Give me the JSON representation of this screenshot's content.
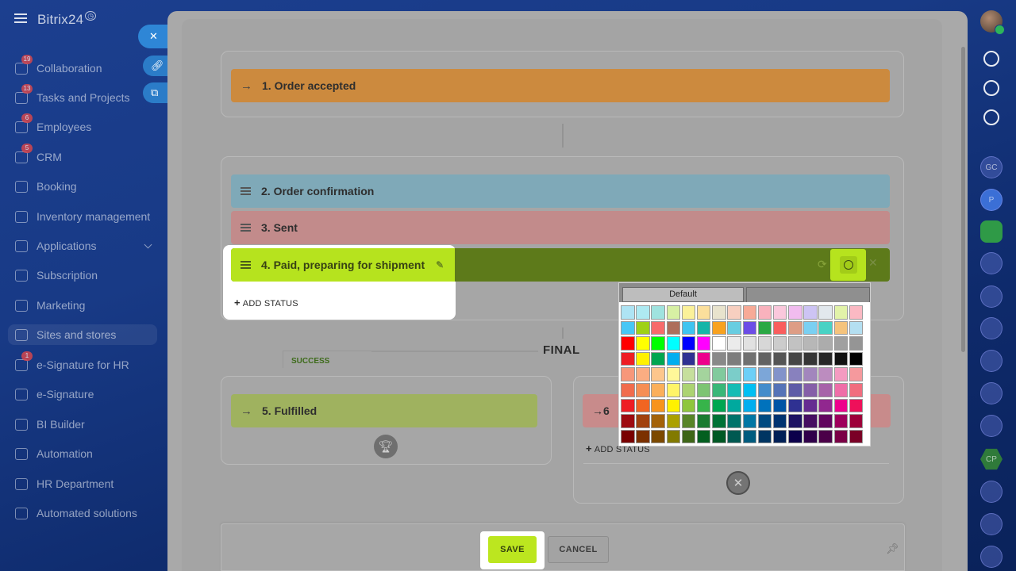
{
  "app": {
    "logo": "Bitrix24"
  },
  "sidebar": {
    "items": [
      {
        "label": "Collaboration",
        "badge": "19"
      },
      {
        "label": "Tasks and Projects",
        "badge": "13"
      },
      {
        "label": "Employees",
        "badge": "6"
      },
      {
        "label": "CRM",
        "badge": "5"
      },
      {
        "label": "Booking",
        "badge": ""
      },
      {
        "label": "Inventory management",
        "badge": ""
      },
      {
        "label": "Applications",
        "badge": ""
      },
      {
        "label": "Subscription",
        "badge": ""
      },
      {
        "label": "Marketing",
        "badge": ""
      },
      {
        "label": "Sites and stores",
        "badge": ""
      },
      {
        "label": "e-Signature for HR",
        "badge": "1"
      },
      {
        "label": "e-Signature",
        "badge": ""
      },
      {
        "label": "BI Builder",
        "badge": ""
      },
      {
        "label": "Automation",
        "badge": ""
      },
      {
        "label": "HR Department",
        "badge": ""
      },
      {
        "label": "Automated solutions",
        "badge": ""
      }
    ]
  },
  "rail": {
    "avatars": [
      "GC",
      "P",
      "CP"
    ]
  },
  "stages": {
    "start": "1. Order accepted",
    "s2": "2. Order confirmation",
    "s3": "3. Sent",
    "s4": "4. Paid, preparing for shipment",
    "add_status": "ADD STATUS",
    "final_label": "FINAL",
    "success_tab": "SUCCESS",
    "s5": "5. Fulfilled",
    "s6": "6"
  },
  "picker": {
    "tab_default": "Default",
    "colors": [
      [
        "#aee4f4",
        "#aeeaf2",
        "#9fe3df",
        "#d7f0a4",
        "#fbf19a",
        "#fbdf9c",
        "#e8e3cd",
        "#f7cfc0",
        "#f7aa97",
        "#f9b2bd",
        "#fac8dc",
        "#f1bcef",
        "#cdc4f4",
        "#e2e8ed",
        "#e2f3a9",
        "#fbb9c3"
      ],
      [
        "#47c7f5",
        "#9fd116",
        "#f76b6b",
        "#ad6e5b",
        "#3ec4f0",
        "#15b5a8",
        "#f8a21f",
        "#68cde1",
        "#6c4de6",
        "#2aa844",
        "#f95e5e",
        "#dd9d85",
        "#7ad0f2",
        "#48d2c4",
        "#f5c37c",
        "#b4dff1"
      ],
      [
        "#ff0000",
        "#ffff00",
        "#00ff00",
        "#00ffff",
        "#0000ff",
        "#ff00ff",
        "#ffffff",
        "#ebebeb",
        "#e1e1e1",
        "#d7d7d7",
        "#cccccc",
        "#c2c2c2",
        "#b7b7b7",
        "#acacac",
        "#a0a0a0",
        "#959595"
      ],
      [
        "#ee1d24",
        "#fff100",
        "#00a650",
        "#00aeef",
        "#2f3192",
        "#ed008c",
        "#898989",
        "#7d7d7d",
        "#707070",
        "#626262",
        "#555555",
        "#464646",
        "#363636",
        "#262626",
        "#111111",
        "#000000"
      ],
      [
        "#f7977a",
        "#fbad82",
        "#fdc68c",
        "#fff799",
        "#c6df9c",
        "#a4d49d",
        "#81ca9d",
        "#7bcdc9",
        "#6ccff7",
        "#7ca6d8",
        "#8293ca",
        "#8881be",
        "#a286bd",
        "#bc8cbf",
        "#f49bc1",
        "#f5999d"
      ],
      [
        "#f16c4d",
        "#f68e54",
        "#fbaf5a",
        "#fff467",
        "#acd372",
        "#7dc473",
        "#39b778",
        "#16bcb4",
        "#00bff3",
        "#438ccb",
        "#5573b7",
        "#5e5ca7",
        "#855fa8",
        "#a763a9",
        "#ef6ea8",
        "#f16d7e"
      ],
      [
        "#ee1d24",
        "#f16522",
        "#f7941d",
        "#fff100",
        "#8fc63d",
        "#37b44a",
        "#00a650",
        "#00a99e",
        "#00aeef",
        "#0072bc",
        "#0054a5",
        "#2f3192",
        "#652c91",
        "#91278f",
        "#ed008c",
        "#ee105a"
      ],
      [
        "#9d0a0f",
        "#a1410d",
        "#a36209",
        "#aba000",
        "#588528",
        "#197b30",
        "#007236",
        "#00736a",
        "#0076a4",
        "#004a80",
        "#003370",
        "#1d1363",
        "#450e61",
        "#62055f",
        "#9e005c",
        "#9d0039"
      ],
      [
        "#790000",
        "#7b3000",
        "#7c4900",
        "#827a00",
        "#3e6617",
        "#045f20",
        "#005824",
        "#005951",
        "#005b7e",
        "#003562",
        "#002056",
        "#0c004b",
        "#30004a",
        "#4b0048",
        "#7a0045",
        "#7a0026"
      ]
    ]
  },
  "footer": {
    "save": "SAVE",
    "cancel": "CANCEL"
  },
  "colors": {
    "stage_start": "#cc8a3e",
    "stage_s2": "#7fa9b8",
    "stage_s3": "#c28b8b",
    "stage_s4": "#b6e31e",
    "stage_s5": "#9fb25f",
    "stage_s6": "#c88b8b",
    "accent_lime": "#bce61f"
  }
}
